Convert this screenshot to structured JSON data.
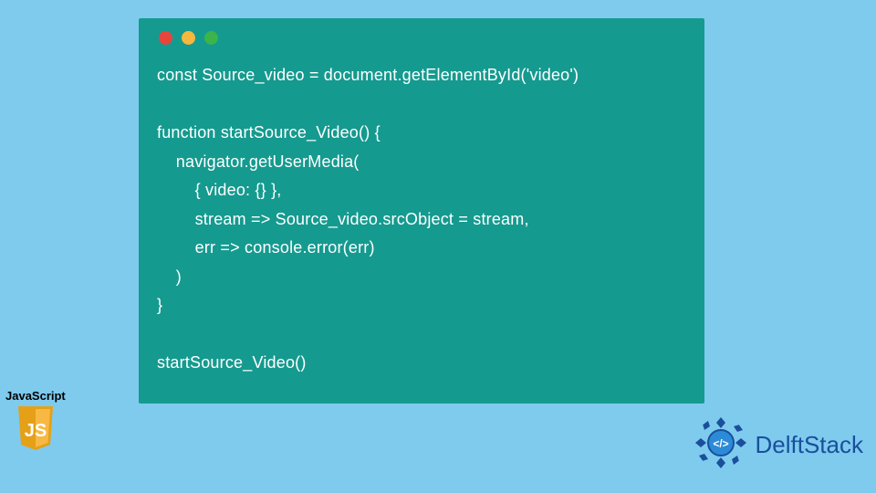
{
  "code_window": {
    "lines": [
      "const Source_video = document.getElementById('video')",
      "",
      "function startSource_Video() {",
      "    navigator.getUserMedia(",
      "        { video: {} },",
      "        stream => Source_video.srcObject = stream,",
      "        err => console.error(err)",
      "    )",
      "}",
      "",
      "startSource_Video()"
    ]
  },
  "js_badge": {
    "label": "JavaScript",
    "shield_text": "JS"
  },
  "delft_badge": {
    "text": "DelftStack"
  },
  "colors": {
    "page_bg": "#7ecbee",
    "window_bg": "#159a8f",
    "code_text": "#ffffff",
    "traffic_red": "#e8453c",
    "traffic_yellow": "#f5b83d",
    "traffic_green": "#3bb44a",
    "js_yellow": "#f7b944",
    "delft_blue": "#1a4f9c"
  }
}
